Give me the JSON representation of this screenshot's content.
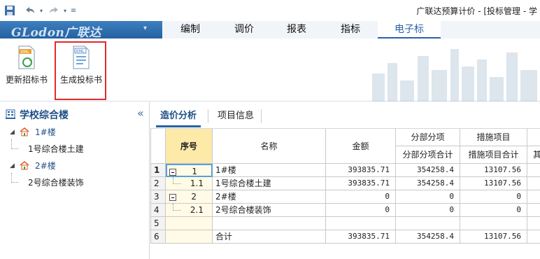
{
  "window": {
    "title": "广联达预算计价 - [投标管理 - 学"
  },
  "logo": {
    "text": "GLodon广联达"
  },
  "menu_tabs": [
    {
      "label": "编制",
      "active": false
    },
    {
      "label": "调价",
      "active": false
    },
    {
      "label": "报表",
      "active": false
    },
    {
      "label": "指标",
      "active": false
    },
    {
      "label": "电子标",
      "active": true
    }
  ],
  "ribbon": {
    "buttons": [
      {
        "label": "更新招标书",
        "icon": "update-xml-icon"
      },
      {
        "label": "生成投标书",
        "icon": "generate-xml-icon"
      }
    ]
  },
  "project_tree": {
    "title": "学校综合楼",
    "nodes": [
      {
        "label": "1#楼",
        "type": "building"
      },
      {
        "label": "1号综合楼土建",
        "type": "unit"
      },
      {
        "label": "2#楼",
        "type": "building"
      },
      {
        "label": "2号综合楼装饰",
        "type": "unit"
      }
    ]
  },
  "content_tabs": [
    {
      "label": "造价分析",
      "active": true
    },
    {
      "label": "项目信息",
      "active": false
    }
  ],
  "table": {
    "headers": {
      "seq": "序号",
      "name": "名称",
      "amount": "金额",
      "group_fbfx": "分部分项",
      "group_csxm": "措施项目",
      "fbfx_total": "分部分项合计",
      "csxm_total": "措施项目合计",
      "extra": "其"
    },
    "rows": [
      {
        "row": "1",
        "seq": "1",
        "name": "1#楼",
        "amount": "393835.71",
        "fbfx": "354258.4",
        "csxm": "13107.56",
        "collapse": true
      },
      {
        "row": "2",
        "seq": "1.1",
        "name": "1号综合楼土建",
        "amount": "393835.71",
        "fbfx": "354258.4",
        "csxm": "13107.56",
        "collapse": false
      },
      {
        "row": "3",
        "seq": "2",
        "name": "2#楼",
        "amount": "0",
        "fbfx": "0",
        "csxm": "0",
        "collapse": true
      },
      {
        "row": "4",
        "seq": "2.1",
        "name": "2号综合楼装饰",
        "amount": "0",
        "fbfx": "0",
        "csxm": "0",
        "collapse": false
      },
      {
        "row": "5",
        "seq": "",
        "name": "",
        "amount": "",
        "fbfx": "",
        "csxm": "",
        "collapse": false
      },
      {
        "row": "6",
        "seq": "",
        "name": "合计",
        "amount": "393835.71",
        "fbfx": "354258.4",
        "csxm": "13107.56",
        "collapse": false
      }
    ]
  },
  "colors": {
    "accent": "#2a62a6",
    "menubar": "#2b6aa7",
    "highlight_box": "#e02a2a",
    "seq_column_bg": "#fffbe6"
  }
}
